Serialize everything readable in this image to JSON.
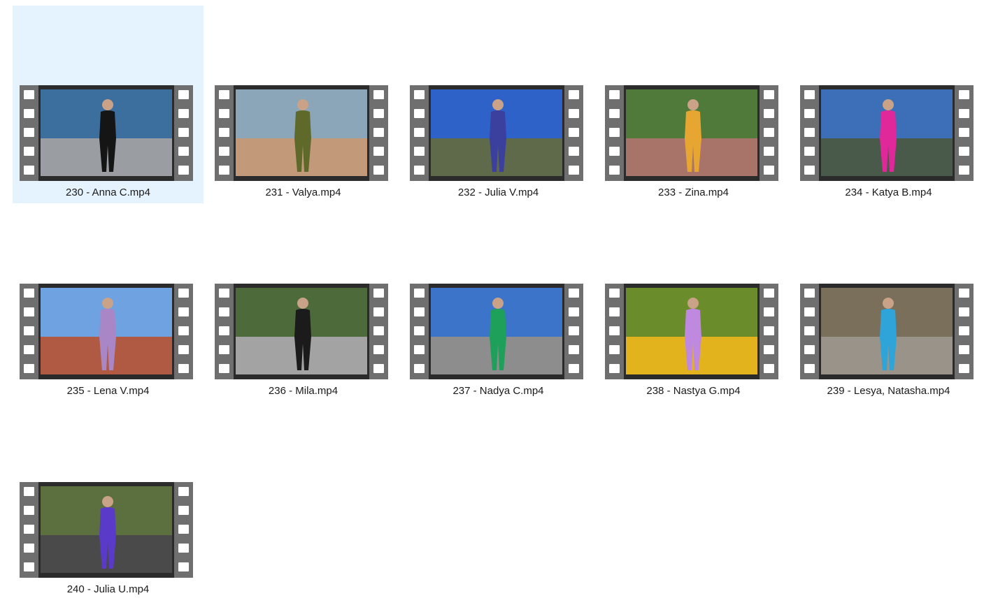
{
  "window": {
    "view": "large-icons"
  },
  "selected_index": 0,
  "items": [
    {
      "label": "230 - Anna C.mp4",
      "thumb_icon": "video-thumbnail-icon",
      "palette": {
        "sky": "#3c6e9e",
        "ground": "#9a9ea3",
        "figure": "#151515"
      }
    },
    {
      "label": "231 - Valya.mp4",
      "thumb_icon": "video-thumbnail-icon",
      "palette": {
        "sky": "#8aa6b8",
        "ground": "#c29a7a",
        "figure": "#5f6a2a"
      }
    },
    {
      "label": "232 - Julia V.mp4",
      "thumb_icon": "video-thumbnail-icon",
      "palette": {
        "sky": "#2f62c8",
        "ground": "#5f6a4a",
        "figure": "#3b3f9e"
      }
    },
    {
      "label": "233 - Zina.mp4",
      "thumb_icon": "video-thumbnail-icon",
      "palette": {
        "sky": "#4f7a3a",
        "ground": "#a8746a",
        "figure": "#e7a531"
      }
    },
    {
      "label": "234 - Katya B.mp4",
      "thumb_icon": "video-thumbnail-icon",
      "palette": {
        "sky": "#3c6fb8",
        "ground": "#4a5a4a",
        "figure": "#e0289a"
      }
    },
    {
      "label": "235 - Lena V.mp4",
      "thumb_icon": "video-thumbnail-icon",
      "palette": {
        "sky": "#6fa2e0",
        "ground": "#b05a44",
        "figure": "#a987c7"
      }
    },
    {
      "label": "236 - Mila.mp4",
      "thumb_icon": "video-thumbnail-icon",
      "palette": {
        "sky": "#4d6a3a",
        "ground": "#a3a3a3",
        "figure": "#1b1b1b"
      }
    },
    {
      "label": "237 - Nadya C.mp4",
      "thumb_icon": "video-thumbnail-icon",
      "palette": {
        "sky": "#3b74c9",
        "ground": "#8d8d8d",
        "figure": "#1fa05a"
      }
    },
    {
      "label": "238 - Nastya G.mp4",
      "thumb_icon": "video-thumbnail-icon",
      "palette": {
        "sky": "#6a8c2a",
        "ground": "#e2b31c",
        "figure": "#c089e0"
      }
    },
    {
      "label": "239 - Lesya, Natasha.mp4",
      "thumb_icon": "video-thumbnail-icon",
      "palette": {
        "sky": "#7a6f5a",
        "ground": "#9a938a",
        "figure": "#2ea4d8"
      }
    },
    {
      "label": "240 - Julia U.mp4",
      "thumb_icon": "video-thumbnail-icon",
      "palette": {
        "sky": "#5c6f3e",
        "ground": "#4a4a4a",
        "figure": "#5a3ac8"
      }
    }
  ]
}
